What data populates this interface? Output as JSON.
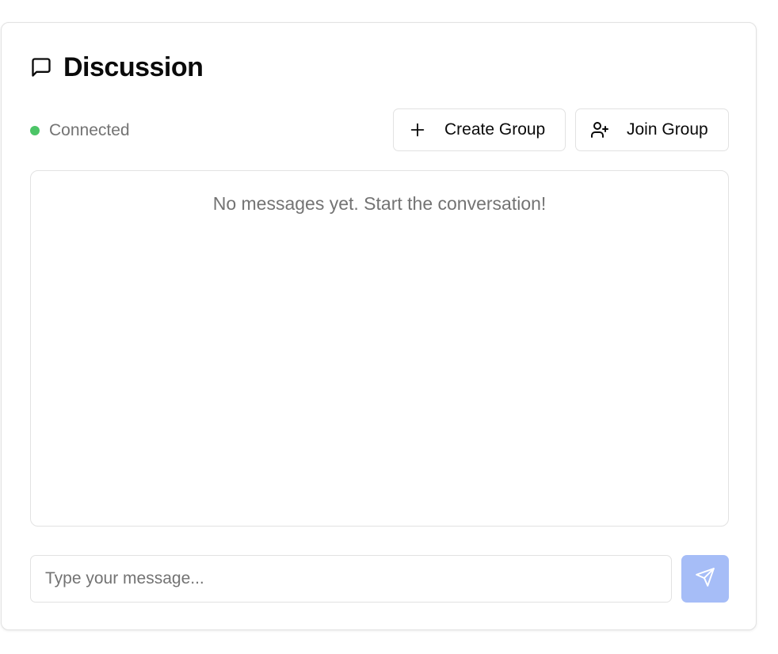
{
  "header": {
    "title": "Discussion",
    "icon": "message-square-icon"
  },
  "status": {
    "label": "Connected",
    "color": "#4cc567"
  },
  "actions": {
    "create_group_label": "Create Group",
    "create_group_icon": "plus-icon",
    "join_group_label": "Join Group",
    "join_group_icon": "user-plus-icon"
  },
  "messages": {
    "empty_text": "No messages yet. Start the conversation!",
    "items": []
  },
  "composer": {
    "placeholder": "Type your message...",
    "value": "",
    "send_icon": "send-icon",
    "send_color": "#a6bdf7"
  }
}
